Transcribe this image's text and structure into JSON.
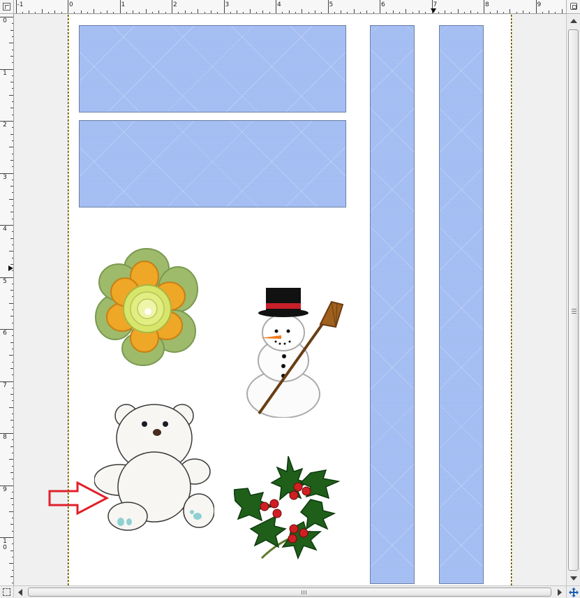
{
  "window": {
    "title": ""
  },
  "rulers": {
    "horizontal_labels": [
      "-1",
      "0",
      "1",
      "2",
      "3",
      "4",
      "5",
      "6",
      "7",
      "8",
      "9"
    ],
    "vertical_labels": [
      "0",
      "1",
      "2",
      "3",
      "4",
      "5",
      "6",
      "7",
      "8",
      "9",
      "10"
    ],
    "unit": "inches"
  },
  "canvas": {
    "page_color": "#ffffff",
    "pasteboard_color": "#f0f0f0",
    "margin_guide_color": "#333333",
    "bleed_guide_color": "#d7b600"
  },
  "shapes": {
    "fill_color": "#a3bdf2",
    "border_color": "#6a7fa6",
    "items": [
      {
        "name": "blue-banner-top"
      },
      {
        "name": "blue-banner-middle"
      },
      {
        "name": "blue-strip-left"
      },
      {
        "name": "blue-strip-right"
      }
    ]
  },
  "cliparts": [
    {
      "name": "felt-flower",
      "icon": "flower-icon"
    },
    {
      "name": "snowman-with-broom",
      "icon": "snowman-icon"
    },
    {
      "name": "teddy-bear",
      "icon": "teddy-bear-icon"
    },
    {
      "name": "holly-sprig",
      "icon": "holly-icon"
    }
  ],
  "annotation": {
    "icon": "red-arrow-icon",
    "color": "#e0202a"
  },
  "scrollbars": {
    "vertical": {
      "position": 0.0
    },
    "horizontal": {
      "position": 0.0
    }
  }
}
